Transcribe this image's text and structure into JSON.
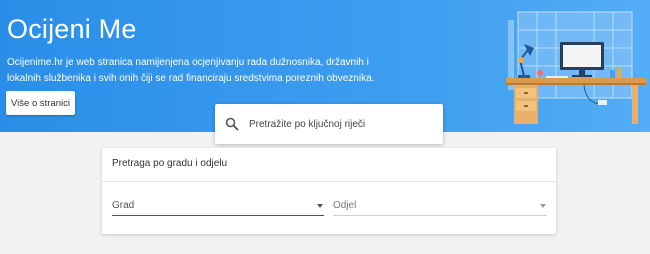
{
  "hero": {
    "title": "Ocijeni Me",
    "description": "Ocijenime.hr je web stranica namijenjena ocjenjivanju rada dužnosnika, državnih i lokalnih službenika i svih onih čiji se rad financiraju sredstvima poreznih obveznika.",
    "about_button": "Više o stranici",
    "background_color": "#2a8ee8"
  },
  "search": {
    "placeholder": "Pretražite po ključnoj riječi",
    "icon": "search-icon"
  },
  "filter": {
    "title": "Pretraga po gradu i odjelu",
    "city_label": "Grad",
    "department_label": "Odjel",
    "dropdown_icon": "caret-down-icon"
  }
}
